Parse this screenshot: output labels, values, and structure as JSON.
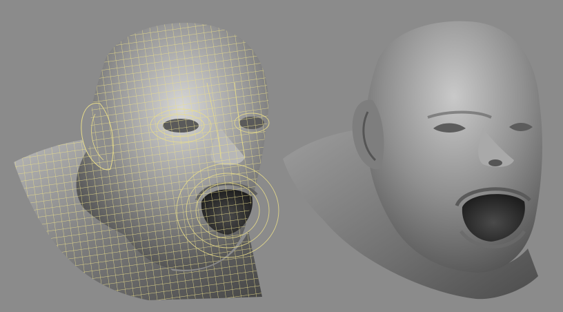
{
  "viewport": {
    "background": "#8b8b8b",
    "panes": [
      {
        "name": "wireframe-render",
        "wire_color": "#e9dd8a",
        "surface": "#6e6e6e",
        "highlight": "#d9d9d9"
      },
      {
        "name": "smooth-render",
        "surface": "#707070",
        "highlight": "#c8c8c8"
      }
    ]
  }
}
